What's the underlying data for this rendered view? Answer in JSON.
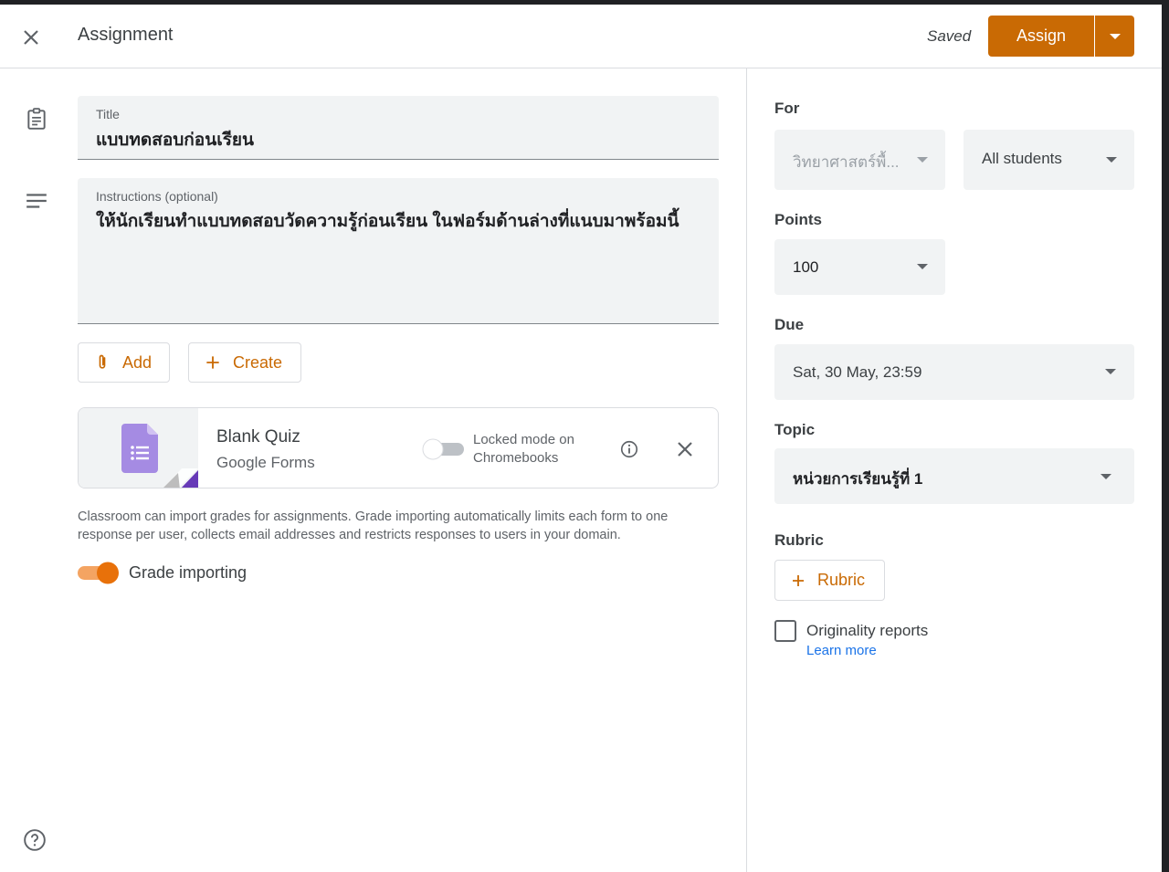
{
  "header": {
    "title": "Assignment",
    "status": "Saved",
    "assign_label": "Assign"
  },
  "form": {
    "title_label": "Title",
    "title_value": "แบบทดสอบก่อนเรียน",
    "instructions_label": "Instructions (optional)",
    "instructions_value": "ให้นักเรียนทำแบบทดสอบวัดความรู้ก่อนเรียน ในฟอร์มด้านล่างที่แนบมาพร้อมนี้"
  },
  "actions": {
    "add_label": "Add",
    "create_label": "Create"
  },
  "attachment": {
    "title": "Blank Quiz",
    "subtitle": "Google Forms",
    "locked_mode_line1": "Locked mode on",
    "locked_mode_line2": "Chromebooks",
    "locked_mode_on": false
  },
  "grade_note": "Classroom can import grades for assignments. Grade importing automatically limits each form to one response per user, collects email addresses and restricts responses to users in your domain.",
  "grade_importing": {
    "label": "Grade importing",
    "enabled": true
  },
  "sidebar": {
    "for_label": "For",
    "class_value": "วิทยาศาสตร์พื้...",
    "students_value": "All students",
    "points_label": "Points",
    "points_value": "100",
    "due_label": "Due",
    "due_value": "Sat, 30 May, 23:59",
    "topic_label": "Topic",
    "topic_value": "หน่วยการเรียนรู้ที่ 1",
    "rubric_label": "Rubric",
    "rubric_button": "Rubric",
    "originality_label": "Originality reports",
    "learn_more": "Learn more",
    "originality_checked": false
  },
  "colors": {
    "accent": "#c96a04",
    "toggle_on_track": "#f4a462",
    "toggle_on_thumb": "#e8710a",
    "forms_purple": "#673ab7",
    "link": "#1a73e8"
  },
  "icons": {
    "close": "close-icon",
    "assignment": "assignment-icon",
    "notes": "notes-icon",
    "attach": "paperclip-icon",
    "create": "plus-icon",
    "forms": "google-forms-icon",
    "info": "info-icon",
    "help": "help-icon"
  }
}
